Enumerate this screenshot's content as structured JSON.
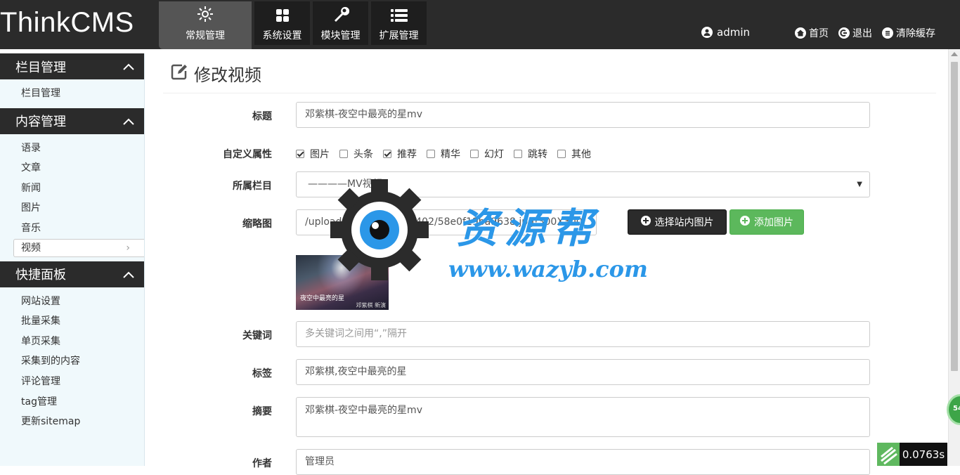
{
  "app": {
    "logo": "ThinkCMS"
  },
  "topnav": [
    {
      "label": "常规管理",
      "icon": "sun-icon",
      "active": true
    },
    {
      "label": "系统设置",
      "icon": "grid-icon"
    },
    {
      "label": "模块管理",
      "icon": "wrench-icon"
    },
    {
      "label": "扩展管理",
      "icon": "list-icon"
    }
  ],
  "user": {
    "name": "admin",
    "icon": "user-icon"
  },
  "toplinks": {
    "home": "首页",
    "logout": "退出",
    "clear_cache": "清除缓存"
  },
  "sidebar": {
    "sections": [
      {
        "title": "栏目管理",
        "items": [
          "栏目管理"
        ]
      },
      {
        "title": "内容管理",
        "items": [
          "语录",
          "文章",
          "新闻",
          "图片",
          "音乐",
          "视频"
        ],
        "active_item": "视频"
      },
      {
        "title": "快捷面板",
        "items": [
          "网站设置",
          "批量采集",
          "单页采集",
          "采集到的内容",
          "评论管理",
          "tag管理",
          "更新sitemap"
        ]
      }
    ]
  },
  "page": {
    "title": "修改视频"
  },
  "form": {
    "title": {
      "label": "标题",
      "value": "邓紫棋-夜空中最亮的星mv"
    },
    "attributes": {
      "label": "自定义属性",
      "options": [
        {
          "name": "图片",
          "checked": true
        },
        {
          "name": "头条",
          "checked": false
        },
        {
          "name": "推荐",
          "checked": true
        },
        {
          "name": "精华",
          "checked": false
        },
        {
          "name": "幻灯",
          "checked": false
        },
        {
          "name": "跳转",
          "checked": false
        },
        {
          "name": "其他",
          "checked": false
        }
      ]
    },
    "category": {
      "label": "所属栏目",
      "value": "————MV视频"
    },
    "thumbnail": {
      "label": "缩略图",
      "value": "/uploads/image/20170402/58e0f19ba9638.jpg!300X300.",
      "btn_select": "选择站内图片",
      "btn_add": "添加图片",
      "caption": "夜空中最亮的星",
      "caption_small": "邓紫棋 新演"
    },
    "keywords": {
      "label": "关键词",
      "placeholder": "多关键词之间用“,”隔开"
    },
    "tags": {
      "label": "标签",
      "value": "邓紫棋,夜空中最亮的星"
    },
    "summary": {
      "label": "摘要",
      "value": "邓紫棋-夜空中最亮的星mv"
    },
    "author": {
      "label": "作者",
      "value": "管理员"
    }
  },
  "watermark": {
    "text": "资源帮",
    "url": "www.wazyb.com"
  },
  "widgets": {
    "float_badge": "54",
    "timer": "0.0763s"
  },
  "colors": {
    "dark": "#2b2b2b",
    "green": "#5cb85c",
    "sidebar_bg": "#f0f9fc",
    "watermark": "#2b97e8"
  }
}
